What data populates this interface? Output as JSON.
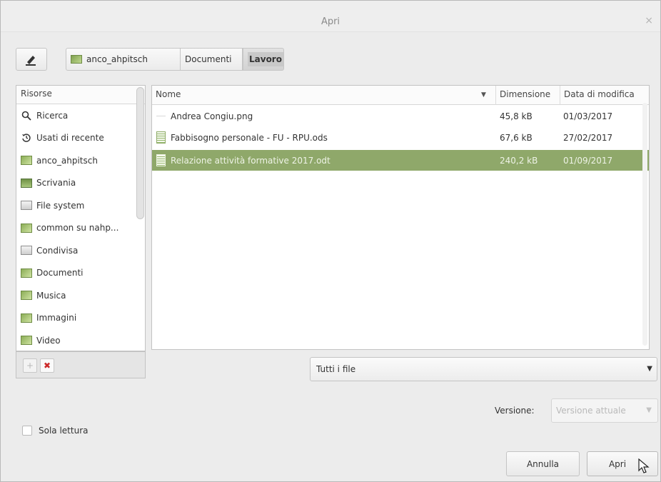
{
  "window": {
    "title": "Apri",
    "close_glyph": "×"
  },
  "pathbar": {
    "back_glyph": "◀",
    "crumbs": [
      "anco_ahpitsch",
      "Documenti",
      "Lavoro"
    ],
    "active_crumb": "Lavoro"
  },
  "sidebar": {
    "header": "Risorse",
    "items": [
      {
        "label": "Ricerca",
        "icon": "search-icon"
      },
      {
        "label": "Usati di recente",
        "icon": "history-icon"
      },
      {
        "label": "anco_ahpitsch",
        "icon": "home-folder-icon"
      },
      {
        "label": "Scrivania",
        "icon": "desktop-icon"
      },
      {
        "label": "File system",
        "icon": "drive-icon"
      },
      {
        "label": "common su nahp...",
        "icon": "network-folder-icon"
      },
      {
        "label": "Condivisa",
        "icon": "drive-icon"
      },
      {
        "label": "Documenti",
        "icon": "documents-folder-icon"
      },
      {
        "label": "Musica",
        "icon": "music-folder-icon"
      },
      {
        "label": "Immagini",
        "icon": "pictures-folder-icon"
      },
      {
        "label": "Video",
        "icon": "video-folder-icon"
      }
    ],
    "add_glyph": "+",
    "remove_glyph": "✖"
  },
  "filelist": {
    "columns": {
      "name": "Nome",
      "size": "Dimensione",
      "date": "Data di modifica"
    },
    "sort_glyph": "▼",
    "rows": [
      {
        "name": "Andrea Congiu.png",
        "size": "45,8 kB",
        "date": "01/03/2017",
        "icon": "image-file-icon",
        "selected": false
      },
      {
        "name": "Fabbisogno personale - FU - RPU.ods",
        "size": "67,6 kB",
        "date": "27/02/2017",
        "icon": "spreadsheet-file-icon",
        "selected": false
      },
      {
        "name": "Relazione attività formative 2017.odt",
        "size": "240,2 kB",
        "date": "01/09/2017",
        "icon": "document-file-icon",
        "selected": true
      }
    ]
  },
  "filter": {
    "value": "Tutti i file",
    "arrow": "▼"
  },
  "version": {
    "label": "Versione:",
    "value": "Versione attuale",
    "arrow": "▼"
  },
  "readonly": {
    "label": "Sola lettura",
    "checked": false
  },
  "buttons": {
    "cancel": "Annulla",
    "open": "Apri"
  },
  "colors": {
    "accent": "#8fa86a",
    "selected_text": "#eef3e6"
  }
}
